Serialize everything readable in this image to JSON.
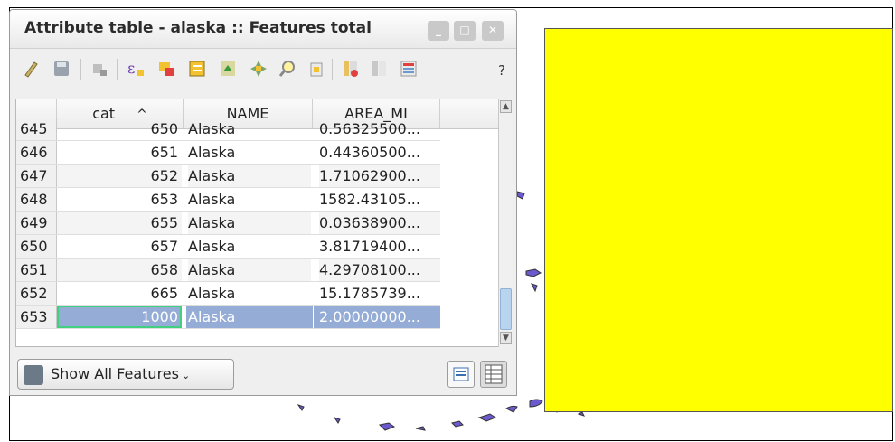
{
  "window": {
    "title": "Attribute table - alaska :: Features total"
  },
  "titlebar_buttons": {
    "minimize": "_",
    "maximize": "□",
    "close": "✕"
  },
  "toolbar": {
    "icons": [
      "toggle-editing-icon",
      "save-edits-icon",
      "delete-selected-icon",
      "expression-select-icon",
      "select-all-icon",
      "invert-selection-icon",
      "move-selection-to-top-icon",
      "pan-to-selected-icon",
      "zoom-to-selected-icon",
      "copy-selected-rows-icon",
      "paste-features-icon",
      "delete-column-icon",
      "new-column-icon",
      "field-calculator-icon"
    ],
    "help_label": "?"
  },
  "table": {
    "columns": [
      "cat",
      "NAME",
      "AREA_MI"
    ],
    "sort_indicator": "^",
    "rows": [
      {
        "id": "645",
        "cat": "650",
        "name": "Alaska",
        "area": "0.56325500..."
      },
      {
        "id": "646",
        "cat": "651",
        "name": "Alaska",
        "area": "0.44360500..."
      },
      {
        "id": "647",
        "cat": "652",
        "name": "Alaska",
        "area": "1.71062900..."
      },
      {
        "id": "648",
        "cat": "653",
        "name": "Alaska",
        "area": "1582.43105..."
      },
      {
        "id": "649",
        "cat": "655",
        "name": "Alaska",
        "area": "0.03638900..."
      },
      {
        "id": "650",
        "cat": "657",
        "name": "Alaska",
        "area": "3.81719400..."
      },
      {
        "id": "651",
        "cat": "658",
        "name": "Alaska",
        "area": "4.29708100..."
      },
      {
        "id": "652",
        "cat": "665",
        "name": "Alaska",
        "area": "15.1785739..."
      },
      {
        "id": "653",
        "cat": "1000",
        "name": "Alaska",
        "area": "2.00000000..."
      }
    ],
    "selected_row": "653"
  },
  "footer": {
    "filter_label": "Show All Features",
    "filter_dropdown": "⌄"
  },
  "colors": {
    "selection": "#94acd6",
    "map_polygon": "#ffff00",
    "islands": "#6a5acd"
  }
}
